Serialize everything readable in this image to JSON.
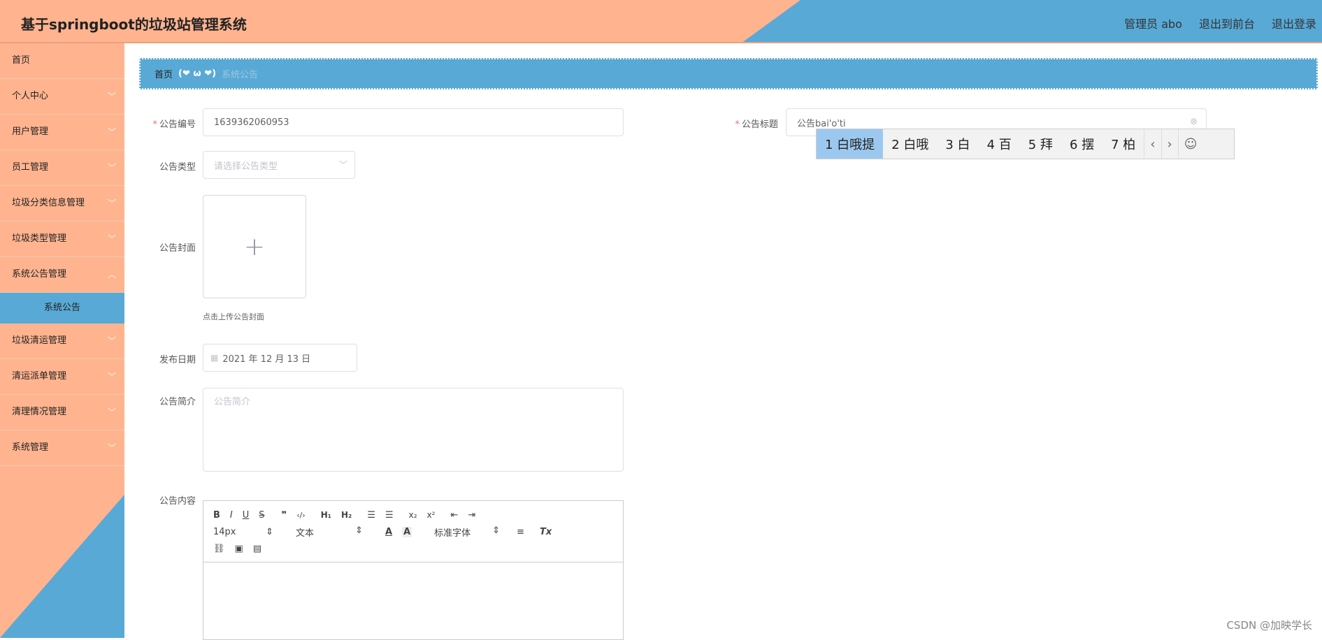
{
  "header": {
    "title": "基于springboot的垃圾站管理系统",
    "admin_label": "管理员 abo",
    "front_link": "退出到前台",
    "logout_link": "退出登录",
    "colors": {
      "peach": "#ffb48f",
      "blue": "#58a9d6"
    }
  },
  "sidebar": {
    "items": [
      {
        "label": "首页"
      },
      {
        "label": "个人中心"
      },
      {
        "label": "用户管理"
      },
      {
        "label": "员工管理"
      },
      {
        "label": "垃圾分类信息管理"
      },
      {
        "label": "垃圾类型管理"
      },
      {
        "label": "系统公告管理"
      },
      {
        "label": "垃圾清运管理"
      },
      {
        "label": "清运派单管理"
      },
      {
        "label": "清理情况管理"
      },
      {
        "label": "系统管理"
      }
    ],
    "active_sub": "系统公告"
  },
  "breadcrumb": {
    "home": "首页",
    "sep": "(❤ ω ❤)",
    "current": "系统公告"
  },
  "form": {
    "number_label": "公告编号",
    "number_value": "1639362060953",
    "title_label": "公告标题",
    "title_value": "公告bai'o'ti",
    "type_label": "公告类型",
    "type_placeholder": "请选择公告类型",
    "cover_label": "公告封面",
    "cover_tip": "点击上传公告封面",
    "date_label": "发布日期",
    "date_value": "2021 年 12 月 13 日",
    "intro_label": "公告简介",
    "intro_placeholder": "公告简介",
    "content_label": "公告内容"
  },
  "editor": {
    "font_size": "14px",
    "block_type": "文本",
    "font_family": "标准字体"
  },
  "ime": {
    "candidates": [
      "1 白哦提",
      "2 白哦",
      "3 白",
      "4 百",
      "5 拜",
      "6 摆",
      "7 柏"
    ]
  },
  "watermark": "CSDN @加映学长"
}
